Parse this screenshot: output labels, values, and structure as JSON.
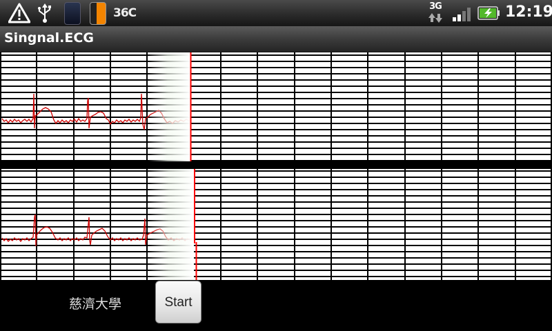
{
  "status_bar": {
    "icons": [
      "warning-icon",
      "usb-icon",
      "app-icon-dark",
      "app-icon-orange",
      "network-3g-icon",
      "signal-strength-icon",
      "battery-charging-icon"
    ],
    "temperature": "36C",
    "network": "3G",
    "time": "12:19"
  },
  "app": {
    "title": "Singnal.ECG"
  },
  "footer": {
    "label": "慈濟大學",
    "start_button": "Start"
  },
  "colors": {
    "trace": "#cc0000",
    "sweep_line": "#ff0000",
    "grid": "#000000",
    "background": "#000000"
  }
}
